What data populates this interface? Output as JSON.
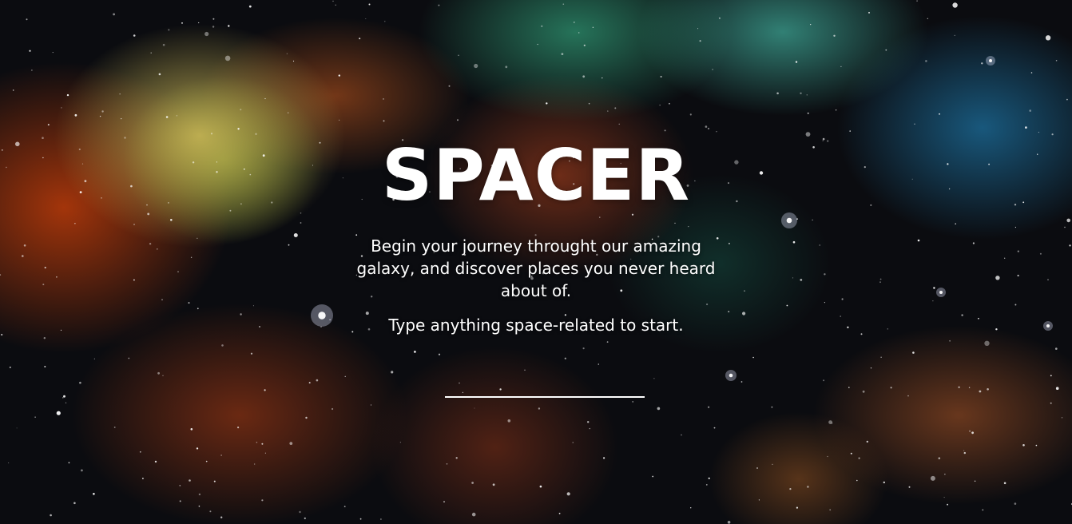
{
  "hero": {
    "title": "SPACER",
    "description": "Begin your journey throught our amazing galaxy, and discover places you never heard about of.",
    "prompt": "Type anything space-related to start."
  },
  "search": {
    "value": "",
    "placeholder": ""
  },
  "colors": {
    "text": "#ffffff",
    "input_underline": "#ffffff",
    "background_base": "#0b0c10"
  }
}
